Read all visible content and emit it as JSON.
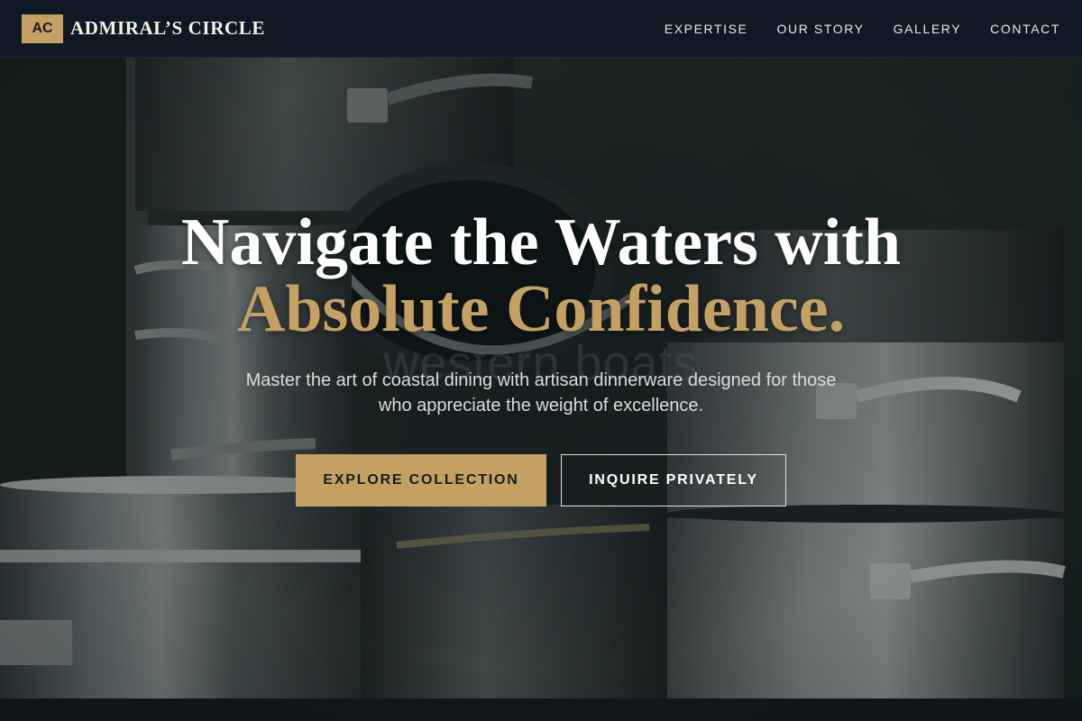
{
  "nav": {
    "logo_mark": "AC",
    "brand": "ADMIRAL’S CIRCLE",
    "links": [
      {
        "label": "EXPERTISE"
      },
      {
        "label": "OUR STORY"
      },
      {
        "label": "GALLERY"
      },
      {
        "label": "CONTACT"
      }
    ]
  },
  "hero": {
    "watermark": "western boats",
    "headline_line1": "Navigate the Waters with",
    "headline_line2": "Absolute Confidence.",
    "subtitle": "Master the art of coastal dining with artisan dinnerware designed for those who appreciate the weight of excellence.",
    "primary_cta": "EXPLORE COLLECTION",
    "secondary_cta": "INQUIRE PRIVATELY",
    "background_image": "stacked-stainless-steel-stockpots"
  },
  "colors": {
    "accent": "#c4a063",
    "nav_bg": "#0f1923",
    "text_light": "#ffffff"
  }
}
